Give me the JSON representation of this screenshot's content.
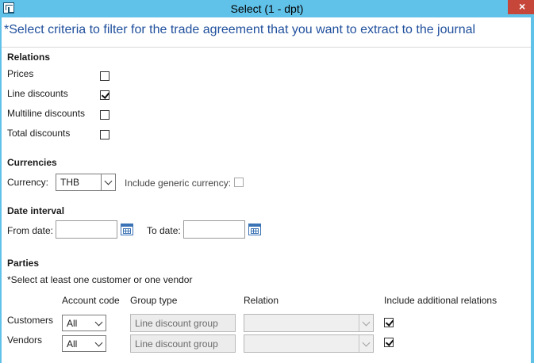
{
  "window": {
    "title": "Select (1 - dpt)",
    "close_glyph": "×"
  },
  "instruction": "*Select criteria to filter for the trade agreement that you want to extract to the journal",
  "relations": {
    "heading": "Relations",
    "items": [
      {
        "label": "Prices",
        "checked": false
      },
      {
        "label": "Line discounts",
        "checked": true
      },
      {
        "label": "Multiline discounts",
        "checked": false
      },
      {
        "label": "Total discounts",
        "checked": false
      }
    ]
  },
  "currencies": {
    "heading": "Currencies",
    "currency_label": "Currency:",
    "currency_value": "THB",
    "generic_label": "Include generic currency:",
    "generic_checked": false
  },
  "date_interval": {
    "heading": "Date interval",
    "from_label": "From date:",
    "from_value": "",
    "to_label": "To date:",
    "to_value": ""
  },
  "parties": {
    "heading": "Parties",
    "note": "*Select at least one customer or one vendor",
    "columns": {
      "account_code": "Account code",
      "group_type": "Group type",
      "relation": "Relation",
      "include_additional": "Include additional relations"
    },
    "rows": [
      {
        "label": "Customers",
        "account_code": "All",
        "group_type": "Line discount group",
        "relation": "",
        "include_additional": true
      },
      {
        "label": "Vendors",
        "account_code": "All",
        "group_type": "Line discount group",
        "relation": "",
        "include_additional": true
      }
    ]
  },
  "icons": {
    "app": "form-window-icon",
    "calendar": "calendar-icon",
    "dropdown": "chevron-down-icon",
    "check": "check-icon"
  },
  "colors": {
    "titlebar": "#61c2e9",
    "instruction_text": "#1f4f9c",
    "close_button": "#c7463a"
  }
}
